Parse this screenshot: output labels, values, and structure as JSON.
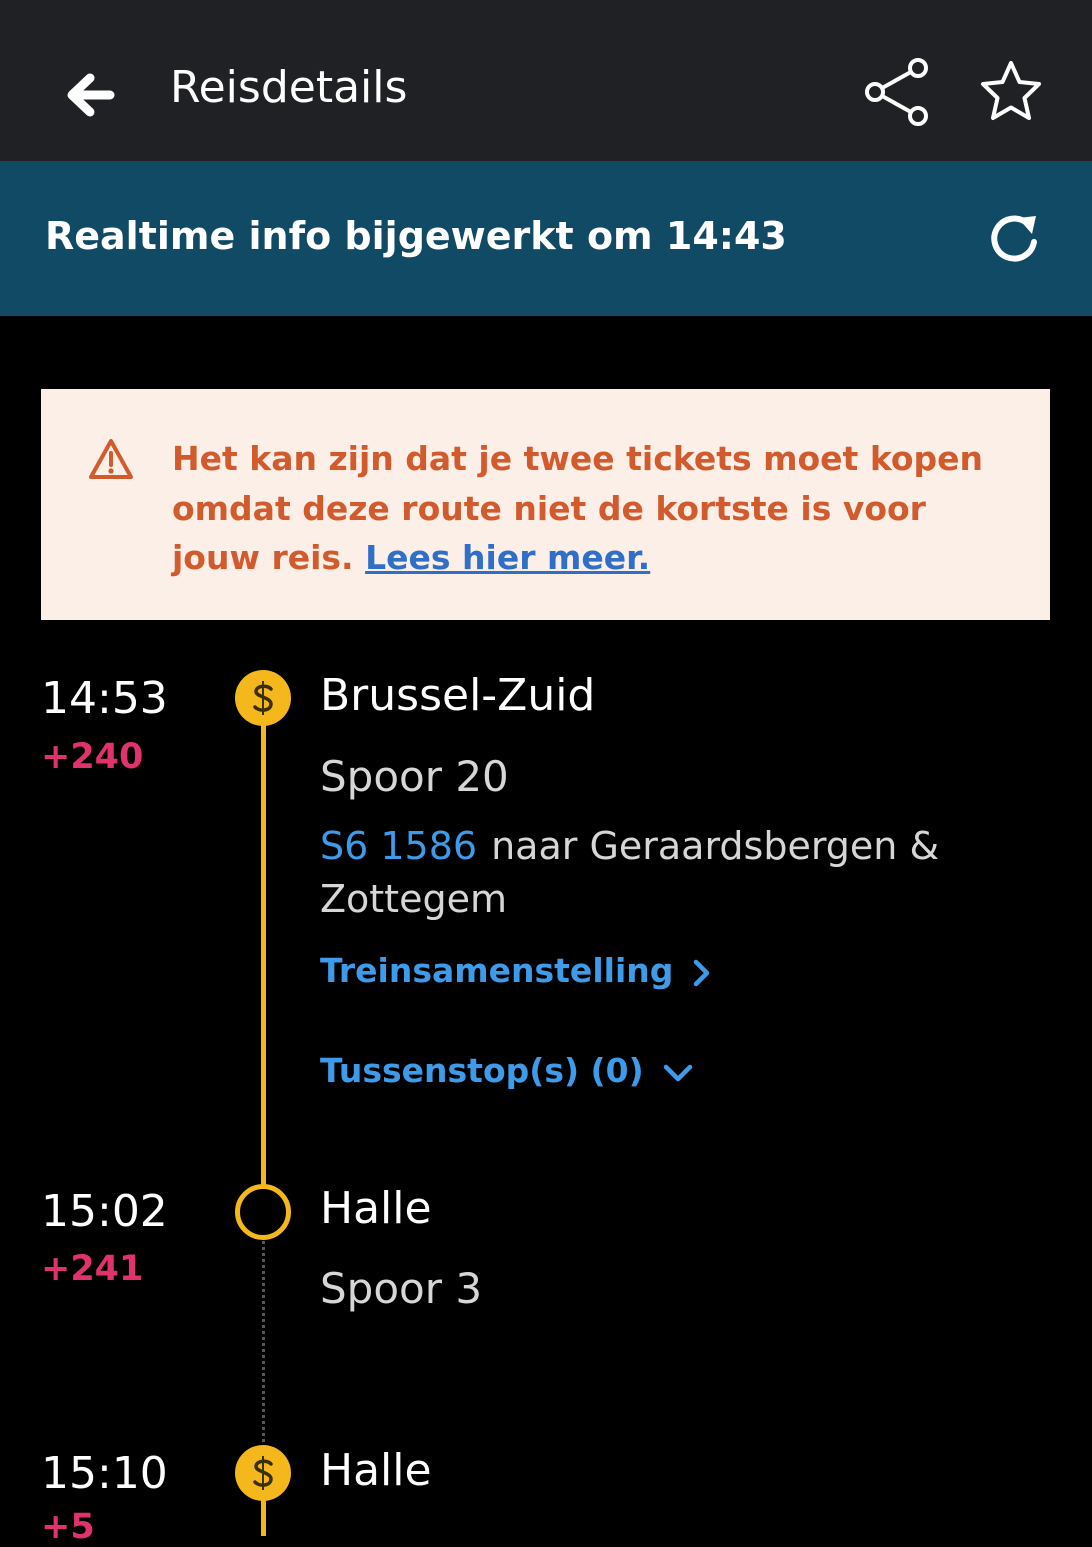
{
  "header": {
    "title": "Reisdetails",
    "back_icon": "arrow-left-icon",
    "share_icon": "share-icon",
    "favorite_icon": "star-icon"
  },
  "realtime": {
    "text": "Realtime info bijgewerkt om 14:43",
    "refresh_icon": "refresh-icon"
  },
  "warning": {
    "icon": "warning-triangle-icon",
    "text": "Het kan zijn dat je twee tickets moet kopen omdat deze route niet de kortste is voor jouw reis. ",
    "link": "Lees hier meer."
  },
  "stops": [
    {
      "time": "14:53",
      "delay": "+240",
      "station": "Brussel-Zuid",
      "platform": "Spoor 20",
      "train_number": "S6 1586",
      "destination": "naar Geraardsbergen & Zottegem",
      "composition_link": "Treinsamenstelling",
      "intermediate_stops": "Tussenstop(s) (0)",
      "node_icon": "s-train-icon"
    },
    {
      "time": "15:02",
      "delay": "+241",
      "station": "Halle",
      "platform": "Spoor 3",
      "node_icon": "stop-ring-icon"
    },
    {
      "time": "15:10",
      "delay": "+5",
      "station": "Halle",
      "node_icon": "s-train-icon"
    }
  ],
  "colors": {
    "topbar": "#202124",
    "infobar": "#114a64",
    "warning_bg": "#fcefe8",
    "warning_text": "#d25b2e",
    "link_blue": "#3d9be9",
    "delay_red": "#e0336b",
    "timeline_yellow": "#f5b81c"
  }
}
